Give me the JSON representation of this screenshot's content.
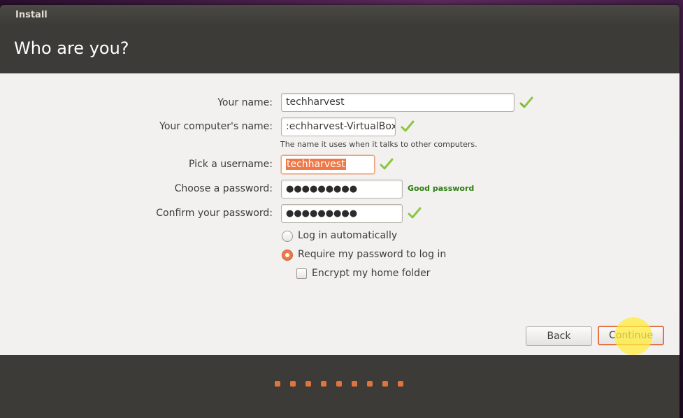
{
  "window": {
    "title": "Install"
  },
  "header": {
    "title": "Who are you?"
  },
  "form": {
    "your_name": {
      "label": "Your name:",
      "value": "techharvest"
    },
    "computer_name": {
      "label": "Your computer's name:",
      "value": ":echharvest-VirtualBox",
      "hint": "The name it uses when it talks to other computers."
    },
    "username": {
      "label": "Pick a username:",
      "value": "techharvest"
    },
    "password": {
      "label": "Choose a password:",
      "value": "●●●●●●●●●",
      "strength": "Good password"
    },
    "confirm_password": {
      "label": "Confirm your password:",
      "value": "●●●●●●●●●"
    }
  },
  "options": {
    "login_auto": {
      "label": "Log in automatically",
      "selected": false
    },
    "require_password": {
      "label": "Require my password to log in",
      "selected": true
    },
    "encrypt_home": {
      "label": "Encrypt my home folder",
      "checked": false
    }
  },
  "buttons": {
    "back": "Back",
    "continue": "Continue"
  },
  "progress": {
    "steps": 9
  },
  "colors": {
    "accent": "#f07746",
    "check": "#8cc63f",
    "good_password": "#2d7d0f"
  },
  "icons": {
    "valid": "checkmark-icon"
  }
}
